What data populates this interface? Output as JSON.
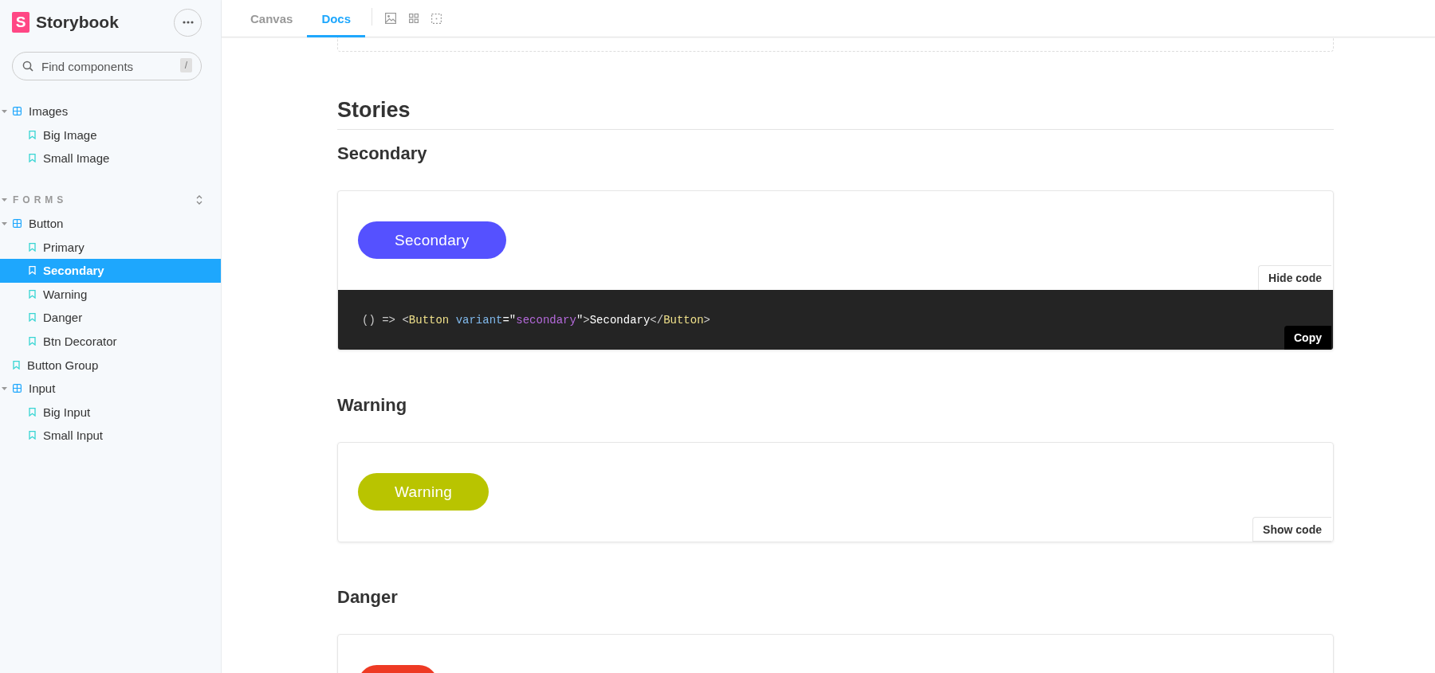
{
  "sidebar": {
    "logo_mark": "S",
    "brand": "Storybook",
    "search": {
      "placeholder": "Find components",
      "shortcut": "/"
    },
    "sections": [
      {
        "items": [
          {
            "label": "Images",
            "kind": "component",
            "expanded": true,
            "children": [
              {
                "label": "Big Image",
                "kind": "story",
                "selected": false
              },
              {
                "label": "Small Image",
                "kind": "story",
                "selected": false
              }
            ]
          }
        ]
      },
      {
        "title": "FORMS",
        "expanded": true,
        "items": [
          {
            "label": "Button",
            "kind": "component",
            "expanded": true,
            "children": [
              {
                "label": "Primary",
                "kind": "story",
                "selected": false
              },
              {
                "label": "Secondary",
                "kind": "story",
                "selected": true
              },
              {
                "label": "Warning",
                "kind": "story",
                "selected": false
              },
              {
                "label": "Danger",
                "kind": "story",
                "selected": false
              },
              {
                "label": "Btn Decorator",
                "kind": "story",
                "selected": false
              }
            ]
          },
          {
            "label": "Button Group",
            "kind": "story",
            "selected": false
          },
          {
            "label": "Input",
            "kind": "component",
            "expanded": true,
            "children": [
              {
                "label": "Big Input",
                "kind": "story",
                "selected": false
              },
              {
                "label": "Small Input",
                "kind": "story",
                "selected": false
              }
            ]
          }
        ]
      }
    ]
  },
  "toolbar": {
    "tabs": [
      {
        "label": "Canvas",
        "selected": false
      },
      {
        "label": "Docs",
        "selected": true
      }
    ]
  },
  "docs": {
    "heading": "Stories",
    "stories": [
      {
        "title": "Secondary",
        "button": {
          "label": "Secondary",
          "kind": "secondary"
        },
        "toggle_label": "Hide code",
        "code_shown": true,
        "copy_label": "Copy",
        "code": [
          {
            "text": "() => ",
            "kind": "punct"
          },
          {
            "text": "<",
            "kind": "punct"
          },
          {
            "text": "Button",
            "kind": "tag"
          },
          {
            "text": " variant",
            "kind": "attr"
          },
          {
            "text": "=\"",
            "kind": "text"
          },
          {
            "text": "secondary",
            "kind": "string"
          },
          {
            "text": "\"",
            "kind": "text"
          },
          {
            "text": ">",
            "kind": "punct"
          },
          {
            "text": "Secondary",
            "kind": "text"
          },
          {
            "text": "</",
            "kind": "punct"
          },
          {
            "text": "Button",
            "kind": "tag"
          },
          {
            "text": ">",
            "kind": "punct"
          }
        ]
      },
      {
        "title": "Warning",
        "button": {
          "label": "Warning",
          "kind": "warning"
        },
        "toggle_label": "Show code",
        "code_shown": false
      },
      {
        "title": "Danger",
        "button": {
          "kind": "danger"
        }
      }
    ]
  }
}
